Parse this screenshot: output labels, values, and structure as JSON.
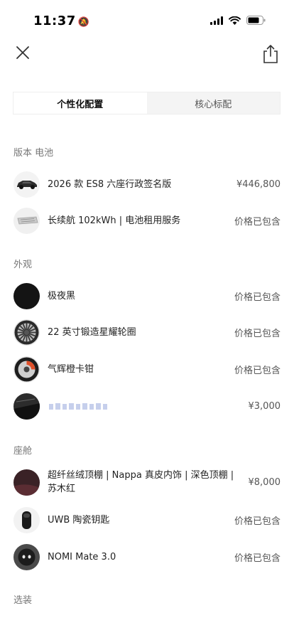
{
  "status_bar": {
    "time": "11:37"
  },
  "tabs": [
    {
      "label": "个性化配置",
      "active": true
    },
    {
      "label": "核心标配",
      "active": false
    }
  ],
  "sections": {
    "version": {
      "title": "版本 电池",
      "items": [
        {
          "label": "2026 款 ES8 六座行政签名版",
          "price": "¥446,800",
          "icon": "car-thumbnail-icon"
        },
        {
          "label": "长续航 102kWh | 电池租用服务",
          "price": "价格已包含",
          "icon": "battery-thumbnail-icon"
        }
      ]
    },
    "exterior": {
      "title": "外观",
      "items": [
        {
          "label": "极夜黑",
          "price": "价格已包含",
          "icon": "paint-swatch-icon"
        },
        {
          "label": "22 英寸锻造星耀轮圈",
          "price": "价格已包含",
          "icon": "wheel-icon"
        },
        {
          "label": "气辉橙卡钳",
          "price": "价格已包含",
          "icon": "brake-caliper-icon"
        },
        {
          "label": "",
          "price": "¥3,000",
          "icon": "roof-thumbnail-icon"
        }
      ]
    },
    "cabin": {
      "title": "座舱",
      "items": [
        {
          "label": "超纤丝绒顶棚 | Nappa 真皮内饰 | 深色顶棚 | 苏木红",
          "price": "¥8,000",
          "icon": "interior-swatch-icon"
        },
        {
          "label": "UWB 陶瓷钥匙",
          "price": "价格已包含",
          "icon": "key-icon"
        },
        {
          "label": "NOMI Mate 3.0",
          "price": "价格已包含",
          "icon": "nomi-icon"
        }
      ]
    },
    "options": {
      "title": "选装"
    }
  },
  "colors": {
    "active_tab_bg": "#ffffff",
    "tab_bar_bg": "#f4f4f4",
    "text": "#222222",
    "muted": "#777777"
  }
}
